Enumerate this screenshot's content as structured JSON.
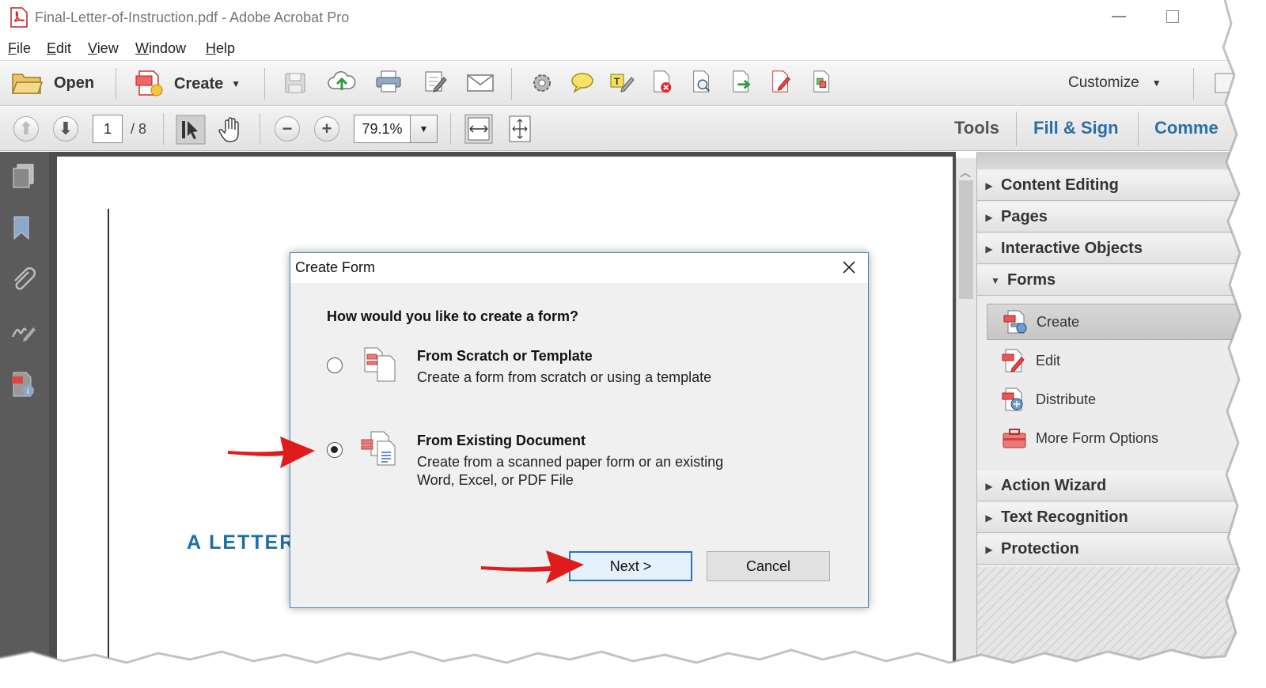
{
  "window": {
    "title": "Final-Letter-of-Instruction.pdf - Adobe Acrobat Pro"
  },
  "menu": [
    "File",
    "Edit",
    "View",
    "Window",
    "Help"
  ],
  "toolbar1": {
    "open_label": "Open",
    "create_label": "Create",
    "customize_label": "Customize"
  },
  "toolbar2": {
    "page_current": "1",
    "page_total": "/ 8",
    "zoom": "79.1%",
    "tools_tab": "Tools",
    "fill_sign_tab": "Fill & Sign",
    "comment_tab": "Comme"
  },
  "document": {
    "heading": "A LETTER"
  },
  "right_panel": {
    "sections": [
      "Content Editing",
      "Pages",
      "Interactive Objects",
      "Forms",
      "Action Wizard",
      "Text Recognition",
      "Protection"
    ],
    "forms_items": [
      "Create",
      "Edit",
      "Distribute",
      "More Form Options"
    ]
  },
  "dialog": {
    "title": "Create Form",
    "question": "How would you like to create a form?",
    "option1_title": "From Scratch or Template",
    "option1_desc": "Create a form from scratch or using a template",
    "option2_title": "From Existing Document",
    "option2_desc_line1": "Create from a scanned paper form or an existing",
    "option2_desc_line2": "Word, Excel, or PDF File",
    "next_label": "Next >",
    "cancel_label": "Cancel",
    "selected_option": 2
  },
  "colors": {
    "accent": "#2a72c5",
    "heading_blue": "#1b6fa8",
    "annotation_arrow": "#e01b1b"
  }
}
